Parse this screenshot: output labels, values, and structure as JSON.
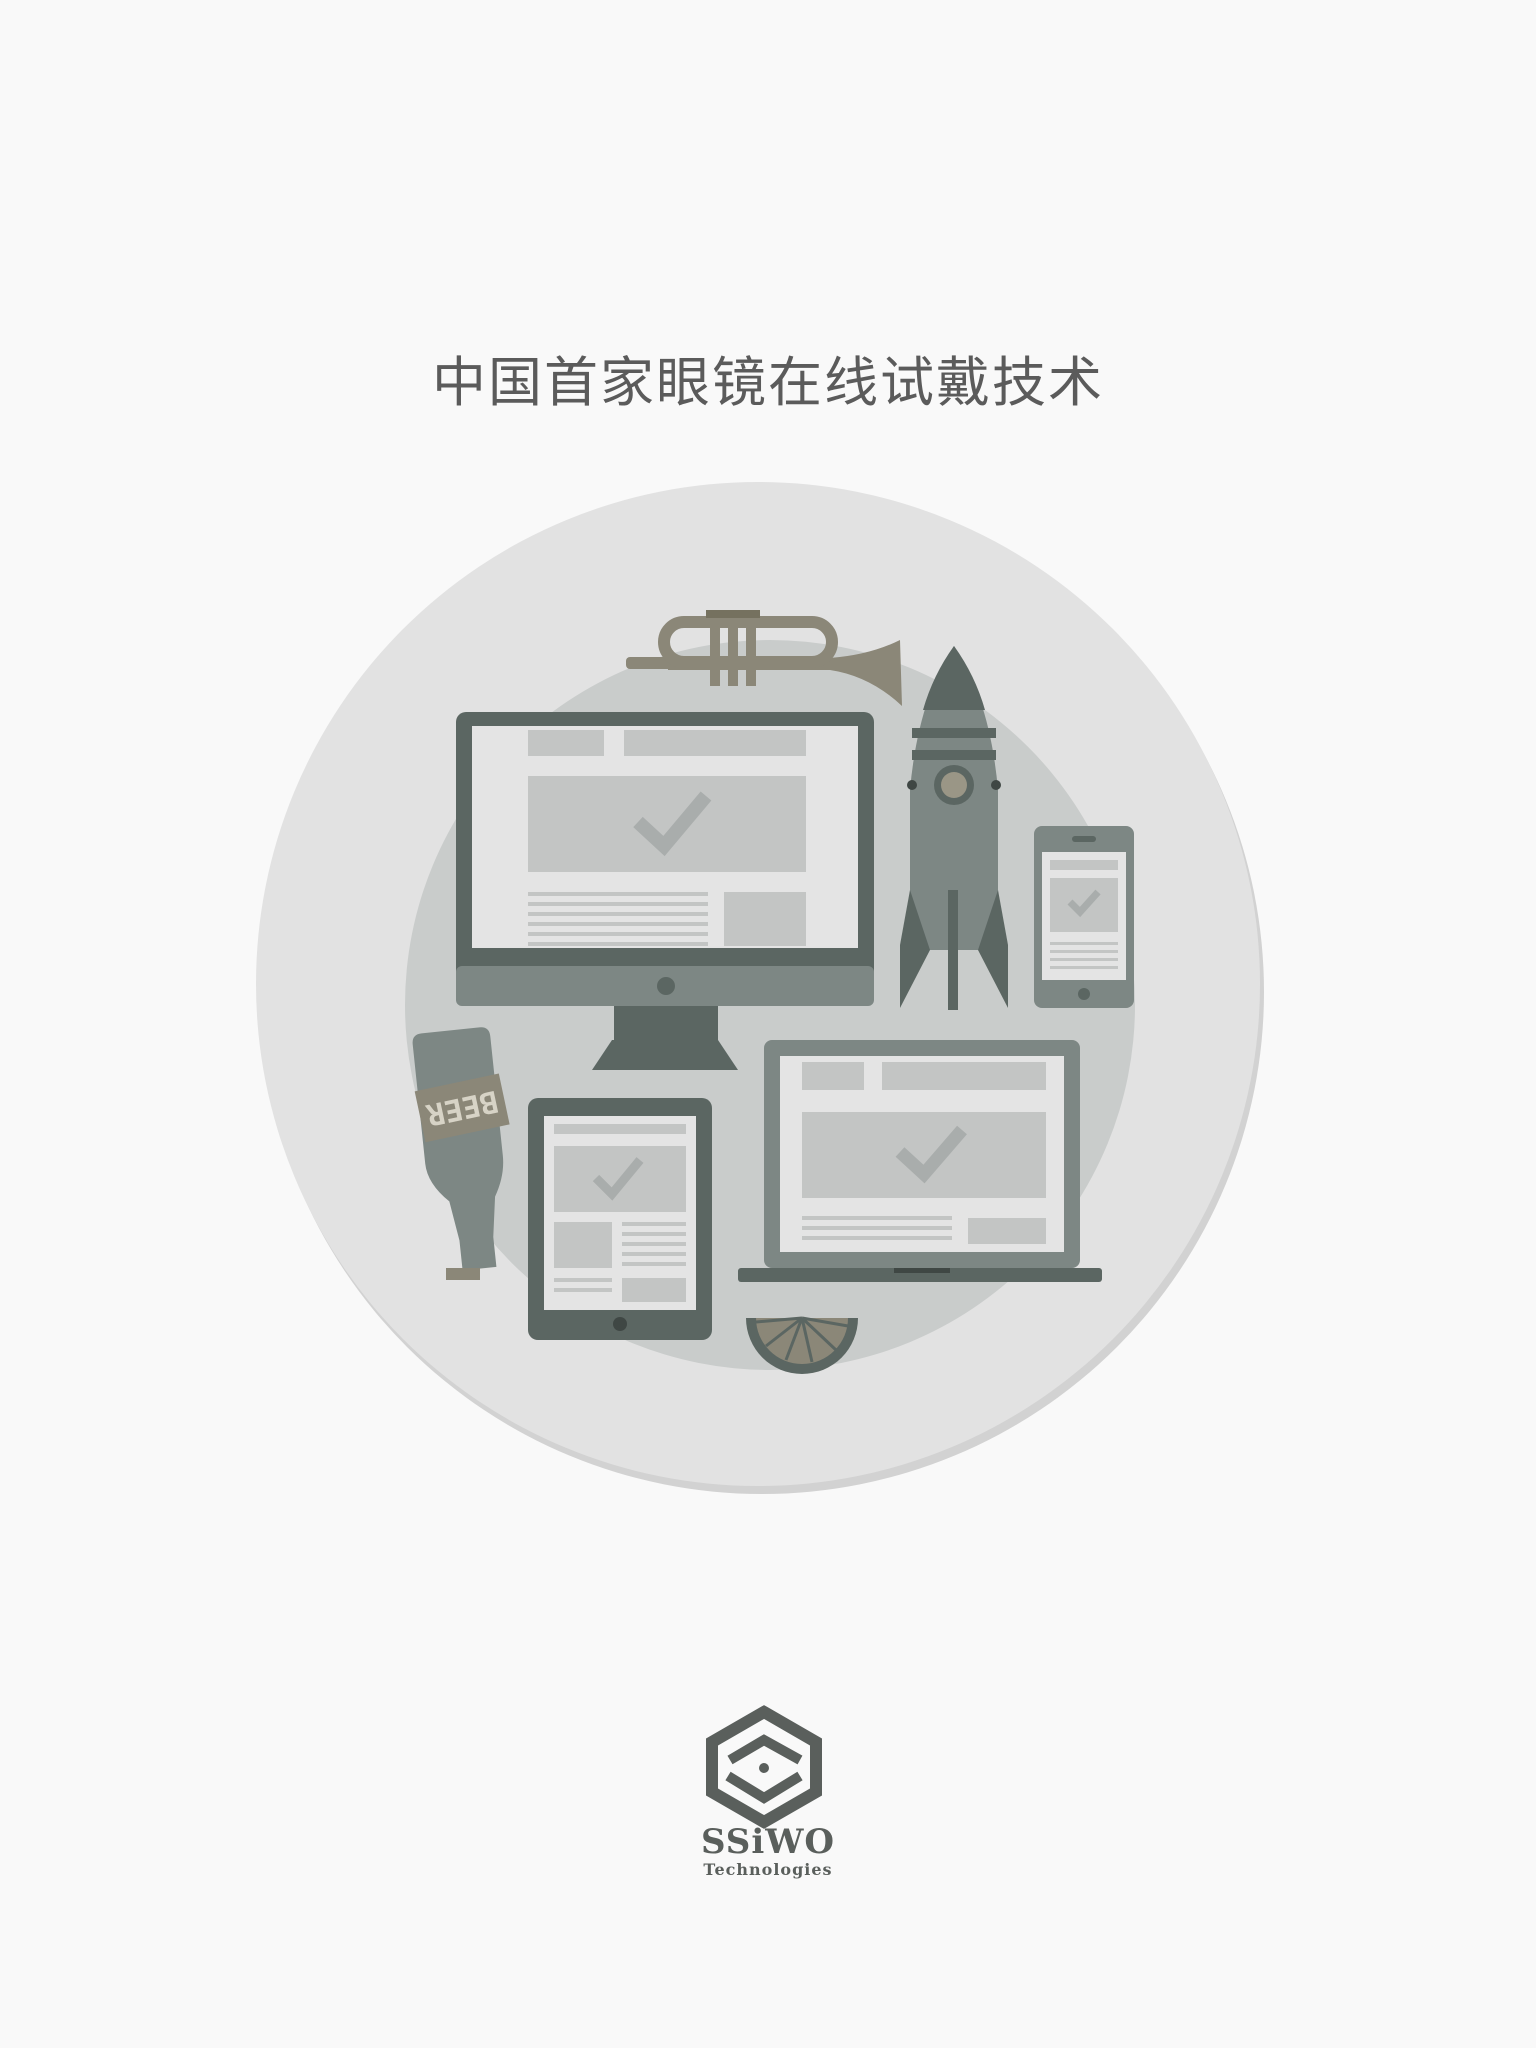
{
  "headline": "中国首家眼镜在线试戴技术",
  "illustration": {
    "beer_label": "BEER"
  },
  "brand": {
    "name": "SSiWO",
    "subtitle": "Technologies"
  },
  "colors": {
    "background": "#f9f9f9",
    "circle_outer": "#e2e2e2",
    "circle_inner": "#c9cccb",
    "dark_slate": "#5b6662",
    "mid_slate": "#7d8784",
    "screen": "#e4e4e4",
    "placeholder": "#c3c5c4",
    "brass": "#8b8778",
    "text": "#5b5b5b"
  },
  "icons": [
    "trumpet-icon",
    "rocket-icon",
    "desktop-monitor-icon",
    "smartphone-icon",
    "beer-bottle-icon",
    "tablet-icon",
    "laptop-icon",
    "checkmark-icon",
    "wheel-icon",
    "ssiwo-logo-icon"
  ]
}
